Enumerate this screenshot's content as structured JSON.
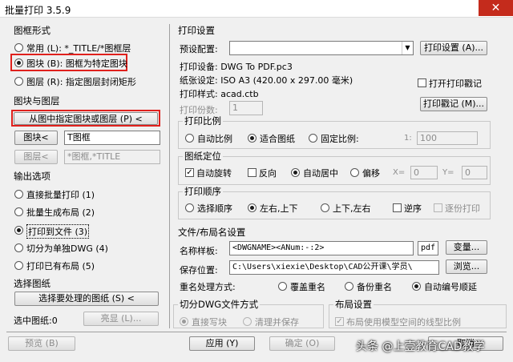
{
  "window": {
    "title": "批量打印 3.5.9",
    "close_icon": "✕"
  },
  "frame_style": {
    "heading": "图框形式",
    "options": [
      {
        "label": "常用 (L): *_TITLE/*图框层",
        "checked": false
      },
      {
        "label": "图块 (B): 图框为特定图块",
        "checked": true
      },
      {
        "label": "图层 (R): 指定图层封闭矩形",
        "checked": false
      }
    ]
  },
  "block_layer": {
    "heading": "图块与图层",
    "pick_button": "从图中指定图块或图层 (P) <",
    "block_button": "图块<",
    "block_value": "T图框",
    "layer_button": "图层<",
    "layer_value": "*图框,*TITLE"
  },
  "output": {
    "heading": "输出选项",
    "options": [
      {
        "label": "直接批量打印 (1)",
        "checked": false
      },
      {
        "label": "批量生成布局 (2)",
        "checked": false
      },
      {
        "label": "打印到文件 (3)",
        "checked": true
      },
      {
        "label": "切分为单独DWG (4)",
        "checked": false
      },
      {
        "label": "打印已有布局 (5)",
        "checked": false
      }
    ]
  },
  "select_drawing": {
    "heading": "选择图纸",
    "select_button": "选择要处理的图纸 (S) <",
    "selected_label": "选中图纸:0",
    "highlight_button": "亮显 (L)..."
  },
  "footer": {
    "preview": "预览 (B)",
    "apply": "应用 (Y)",
    "ok": "确定 (O)",
    "cancel": "取消"
  },
  "print_settings": {
    "heading": "打印设置",
    "preset_label": "预设配置:",
    "preset_value": "",
    "setup_button": "打印设置 (A)...",
    "device": "打印设备: DWG To PDF.pc3",
    "paper": "纸张设定: ISO A3 (420.00 x 297.00 毫米)",
    "style": "打印样式: acad.ctb",
    "log_check": "打开打印戳记",
    "copies_label": "打印份数:",
    "copies_value": "1",
    "log_button": "打印戳记 (M)..."
  },
  "scale": {
    "heading": "打印比例",
    "options": [
      {
        "label": "自动比例",
        "checked": false
      },
      {
        "label": "适合图纸",
        "checked": true
      },
      {
        "label": "固定比例:",
        "checked": false
      }
    ],
    "ratio_prefix": "1:",
    "ratio_value": "100"
  },
  "position": {
    "heading": "图纸定位",
    "auto_rotate": "自动旋转",
    "reverse": "反向",
    "center": "自动居中",
    "offset": "偏移",
    "x_label": "X=",
    "x_value": "0",
    "y_label": "Y=",
    "y_value": "0"
  },
  "order": {
    "heading": "打印顺序",
    "options": [
      {
        "label": "选择顺序",
        "checked": false
      },
      {
        "label": "左右,上下",
        "checked": true
      },
      {
        "label": "上下,左右",
        "checked": false
      }
    ],
    "reverse": "逆序",
    "one_by_one": "逐份打印"
  },
  "file_naming": {
    "heading": "文件/布局名设置",
    "template_label": "名称样板:",
    "template_value": "<DWGNAME><ANum:-:2>",
    "ext_value": "pdf",
    "var_button": "变量...",
    "save_label": "保存位置:",
    "save_value": "C:\\Users\\xiexie\\Desktop\\CAD公开课\\学员\\",
    "browse_button": "浏览...",
    "dup_label": "重名处理方式:",
    "dup_options": [
      {
        "label": "覆盖重名",
        "checked": false
      },
      {
        "label": "备份重名",
        "checked": false
      },
      {
        "label": "自动编号顺延",
        "checked": true
      }
    ]
  },
  "split_dwg": {
    "heading": "切分DWG文件方式",
    "options": [
      {
        "label": "直接写块",
        "checked": true
      },
      {
        "label": "清理并保存",
        "checked": false
      }
    ]
  },
  "layout_settings": {
    "heading": "布局设置",
    "check_label": "布局使用模型空间的线型比例"
  },
  "watermark": "头条 @上壹教育CAD教学"
}
